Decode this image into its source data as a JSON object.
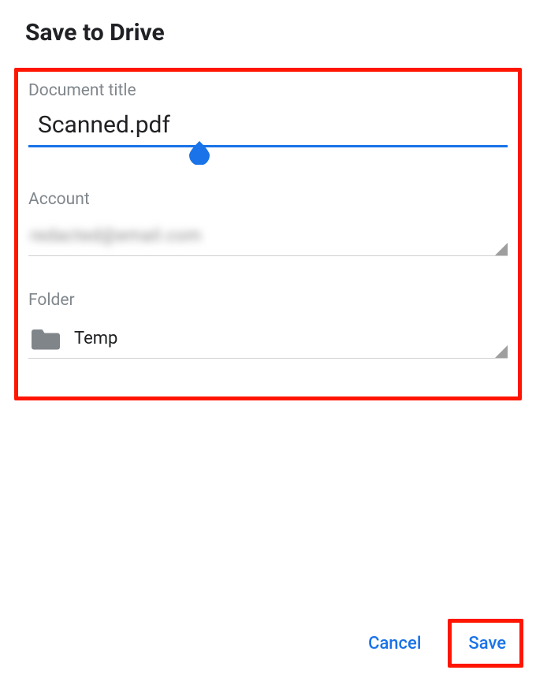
{
  "dialog": {
    "title": "Save to Drive"
  },
  "fields": {
    "document_title": {
      "label": "Document title",
      "value": "Scanned.pdf"
    },
    "account": {
      "label": "Account",
      "value_obscured": "redacted@email.com"
    },
    "folder": {
      "label": "Folder",
      "name": "Temp"
    }
  },
  "buttons": {
    "cancel": "Cancel",
    "save": "Save"
  },
  "colors": {
    "accent": "#1a73e8",
    "highlight": "#ff1500"
  }
}
